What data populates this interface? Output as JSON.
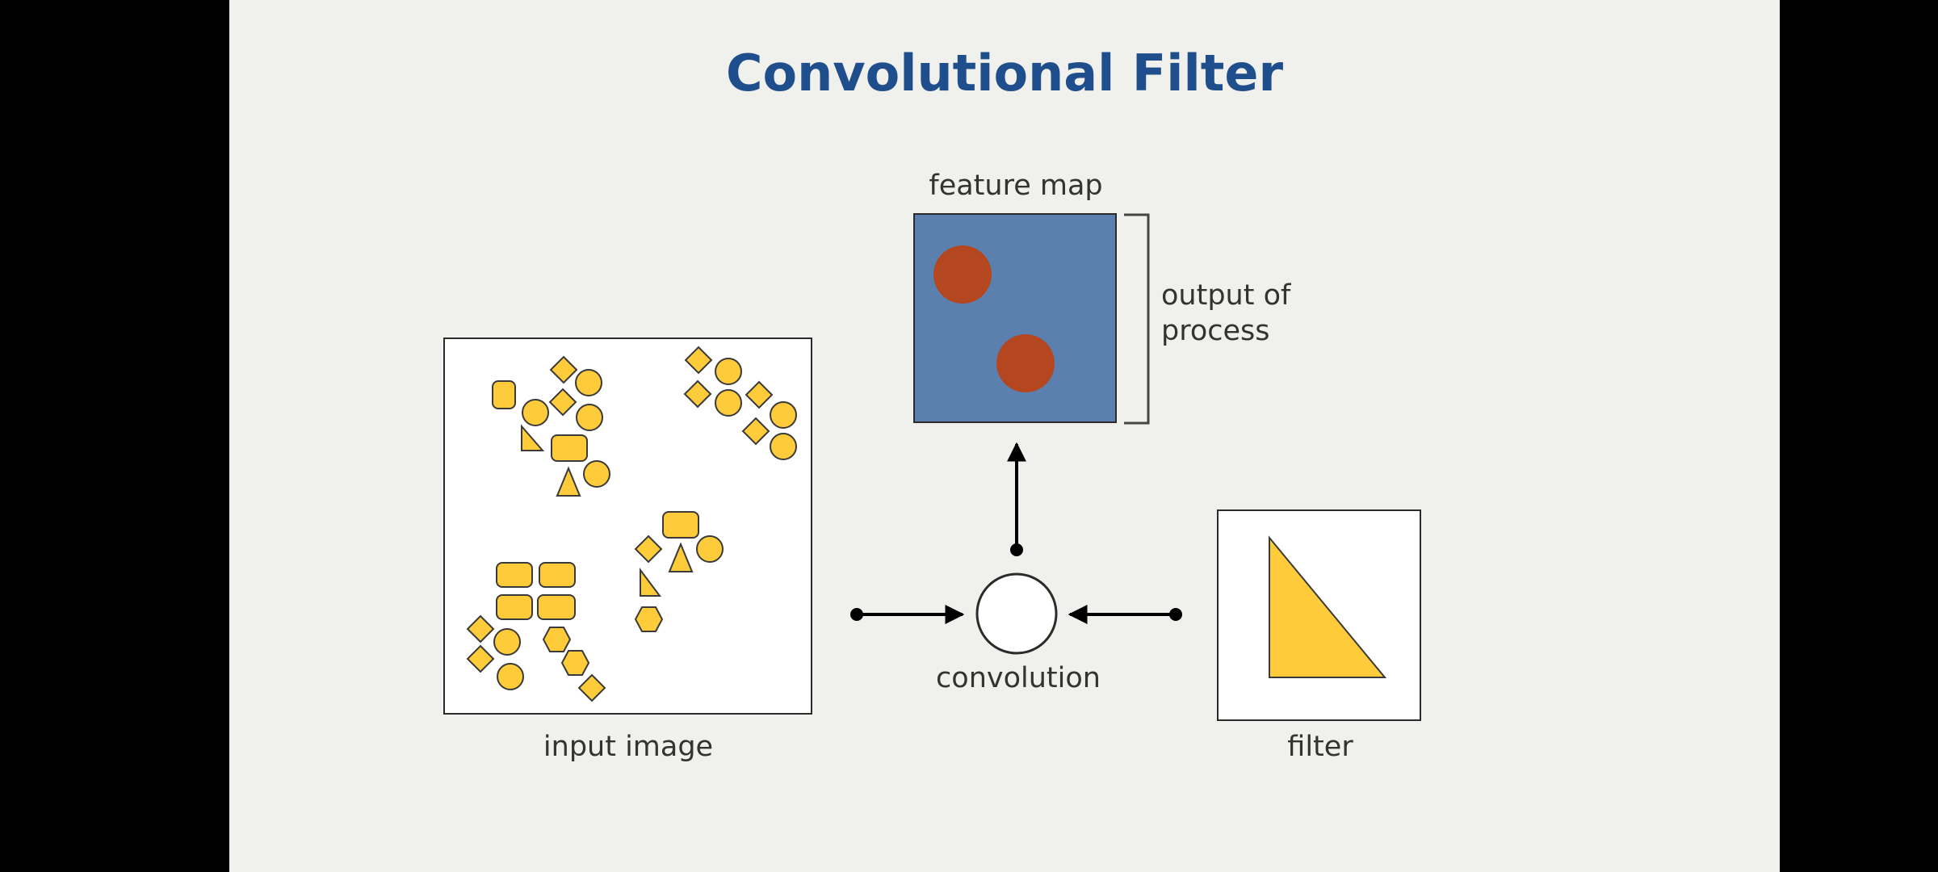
{
  "slide": {
    "title": "Convolutional Filter"
  },
  "diagram": {
    "feature_map": {
      "label": "feature map",
      "fill_color": "#5b7fae",
      "spot_color": "#b4471f",
      "bracket_label_line1": "output of",
      "bracket_label_line2": "process"
    },
    "input_image": {
      "label": "input image",
      "shape_fill": "#fecc3a",
      "shape_stroke": "#3a3a3a"
    },
    "convolution": {
      "label": "convolution"
    },
    "filter": {
      "label": "filter",
      "triangle_fill": "#fecc3a"
    },
    "arrow_color": "#000000"
  }
}
